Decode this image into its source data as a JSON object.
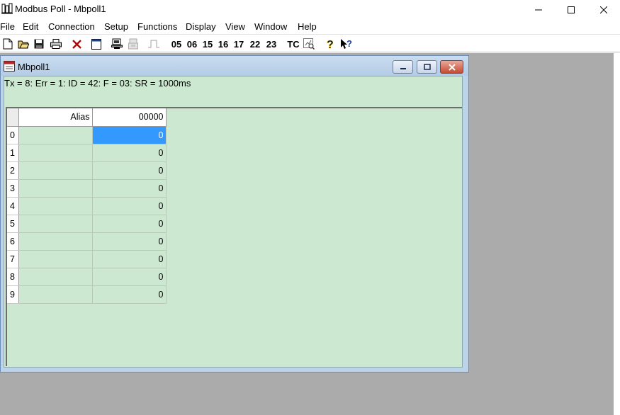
{
  "window": {
    "title": "Modbus Poll - Mbpoll1",
    "icon": "modbus-app-icon"
  },
  "menu": [
    {
      "label": "File"
    },
    {
      "label": "Edit"
    },
    {
      "label": "Connection"
    },
    {
      "label": "Setup"
    },
    {
      "label": "Functions"
    },
    {
      "label": "Display"
    },
    {
      "label": "View"
    },
    {
      "label": "Window"
    },
    {
      "label": "Help"
    }
  ],
  "toolbar": {
    "fc_buttons": [
      "05",
      "06",
      "15",
      "16",
      "17",
      "22",
      "23"
    ],
    "tc_label": "TC",
    "icons": [
      "new-icon",
      "open-icon",
      "save-icon",
      "print-icon",
      "delete-icon",
      "window-icon",
      "connect-icon",
      "disconnect-icon",
      "pulse-icon",
      "monitor-icon",
      "help-icon",
      "context-help-icon"
    ]
  },
  "child": {
    "title": "Mbpoll1",
    "status": "Tx = 8: Err = 1: ID = 42: F = 03: SR = 1000ms",
    "grid": {
      "col_alias": "Alias",
      "col_address": "00000",
      "rows": [
        {
          "index": "0",
          "alias": "",
          "value": "0",
          "selected": true
        },
        {
          "index": "1",
          "alias": "",
          "value": "0"
        },
        {
          "index": "2",
          "alias": "",
          "value": "0"
        },
        {
          "index": "3",
          "alias": "",
          "value": "0"
        },
        {
          "index": "4",
          "alias": "",
          "value": "0"
        },
        {
          "index": "5",
          "alias": "",
          "value": "0"
        },
        {
          "index": "6",
          "alias": "",
          "value": "0"
        },
        {
          "index": "7",
          "alias": "",
          "value": "0"
        },
        {
          "index": "8",
          "alias": "",
          "value": "0"
        },
        {
          "index": "9",
          "alias": "",
          "value": "0"
        }
      ]
    }
  },
  "colors": {
    "grid_background": "#cde8d0",
    "selection": "#3399ff",
    "mdi_background": "#ababab"
  }
}
